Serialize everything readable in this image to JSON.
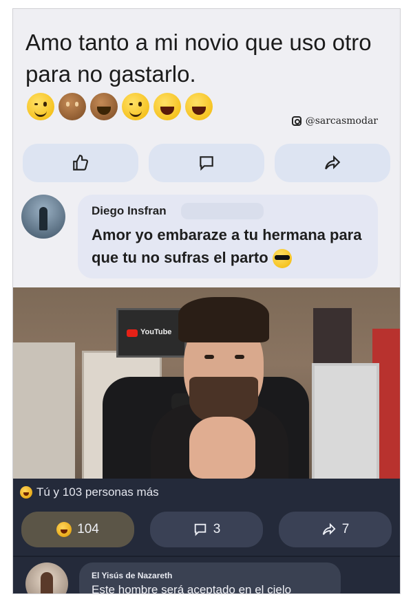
{
  "post": {
    "text": "Amo tanto a mi novio que uso otro para no gastarlo.",
    "emojis": [
      "wink-emoji",
      "see-no-evil-monkey-emoji",
      "hiding-emoji",
      "wink-emoji",
      "laughing-emoji",
      "laughing-tears-emoji"
    ],
    "watermark": "@sarcasmodar"
  },
  "actions_light": {
    "like_icon": "thumbs-up-icon",
    "comment_icon": "comment-icon",
    "share_icon": "share-icon"
  },
  "comment1": {
    "author": "Diego Insfran",
    "text": "Amor yo embaraze a tu hermana para que tu no sufras el parto",
    "emoji": "sunglasses-emoji"
  },
  "photo": {
    "plaque_text": "YouTube"
  },
  "reactions": {
    "summary": "Tú y 103 personas más",
    "like_count": "104",
    "comment_count": "3",
    "share_count": "7"
  },
  "comment2": {
    "author": "El Yisús de Nazareth",
    "text": "Este hombre será aceptado en el cielo"
  },
  "colors": {
    "light_bg": "#efeff3",
    "dark_bg": "#242a3a",
    "button_light": "#dde4f2",
    "button_dark": "#3a4155"
  }
}
